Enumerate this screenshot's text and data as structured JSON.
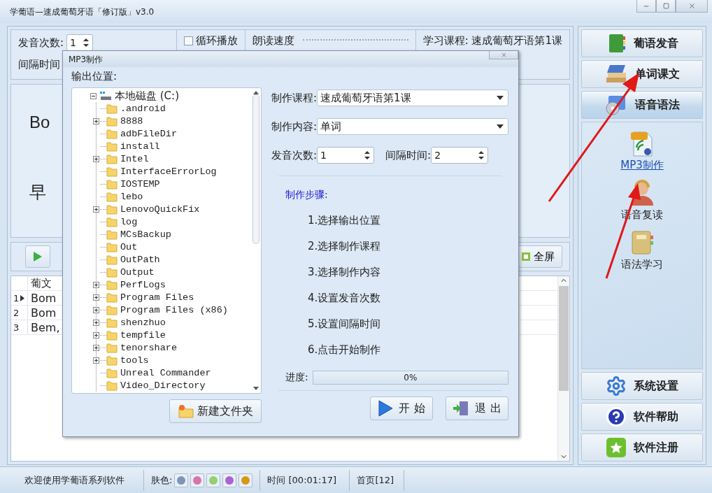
{
  "window": {
    "title": "学葡语—速成葡萄牙语「修订版」v3.0"
  },
  "settings_panel": {
    "repeat_label": "发音次数:",
    "repeat_value": "1",
    "interval_label": "间隔时间",
    "loop": {
      "label": "循环播放",
      "checked": false
    },
    "speed_label": "朗读速度",
    "course": "学习课程: 速成葡萄牙语第1课"
  },
  "display": {
    "word": "Bo",
    "translation": "早"
  },
  "toolbar": {
    "fullscreen_label": "全屏"
  },
  "table": {
    "columns": [
      "葡文"
    ],
    "rows": [
      {
        "index": "1",
        "current": true,
        "text": "Bom"
      },
      {
        "index": "2",
        "current": false,
        "text": "Bom"
      },
      {
        "index": "3",
        "current": false,
        "text": "Bem,"
      }
    ]
  },
  "sidebar": {
    "sections": [
      {
        "label": "葡语发音",
        "selected": false
      },
      {
        "label": "单词课文",
        "selected": false
      },
      {
        "label": "语音语法",
        "selected": true
      }
    ],
    "items": [
      {
        "label": "MP3制作",
        "selected": true
      },
      {
        "label": "语音复读",
        "selected": false
      },
      {
        "label": "语法学习",
        "selected": false
      }
    ],
    "bottom": [
      {
        "label": "系统设置"
      },
      {
        "label": "软件帮助"
      },
      {
        "label": "软件注册"
      }
    ]
  },
  "dialog": {
    "title": "MP3制作",
    "output_label": "输出位置:",
    "tree": [
      {
        "label": "本地磁盘 (C:)",
        "expanded": true,
        "children": [
          {
            "label": ".android",
            "expandable": false
          },
          {
            "label": "8888",
            "expandable": true
          },
          {
            "label": "adbFileDir",
            "expandable": false
          },
          {
            "label": "install",
            "expandable": false
          },
          {
            "label": "Intel",
            "expandable": true
          },
          {
            "label": "InterfaceErrorLog",
            "expandable": false
          },
          {
            "label": "IOSTEMP",
            "expandable": false
          },
          {
            "label": "lebo",
            "expandable": false
          },
          {
            "label": "LenovoQuickFix",
            "expandable": true
          },
          {
            "label": "log",
            "expandable": false
          },
          {
            "label": "MCsBackup",
            "expandable": false
          },
          {
            "label": "Out",
            "expandable": false
          },
          {
            "label": "OutPath",
            "expandable": false
          },
          {
            "label": "Output",
            "expandable": false
          },
          {
            "label": "PerfLogs",
            "expandable": true
          },
          {
            "label": "Program Files",
            "expandable": true
          },
          {
            "label": "Program Files (x86)",
            "expandable": true
          },
          {
            "label": "shenzhuo",
            "expandable": true
          },
          {
            "label": "tempfile",
            "expandable": true
          },
          {
            "label": "tenorshare",
            "expandable": true
          },
          {
            "label": "tools",
            "expandable": true
          },
          {
            "label": "Unreal Commander",
            "expandable": false
          },
          {
            "label": "Video_Directory",
            "expandable": false
          }
        ]
      }
    ],
    "new_folder_button": "新建文件夹",
    "course": {
      "label": "制作课程:",
      "value": "速成葡萄牙语第1课"
    },
    "content": {
      "label": "制作内容:",
      "value": "单词"
    },
    "repeat": {
      "label": "发音次数:",
      "value": "1"
    },
    "interval": {
      "label": "间隔时间:",
      "value": "2"
    },
    "steps_title": "制作步骤:",
    "steps": [
      "1.选择输出位置",
      "2.选择制作课程",
      "3.选择制作内容",
      "4.设置发音次数",
      "5.设置间隔时间",
      "6.点击开始制作"
    ],
    "progress": {
      "label": "进度:",
      "level": 0,
      "text": "0%"
    },
    "start_button": "开 始",
    "exit_button": "退 出"
  },
  "status_bar": {
    "welcome": "欢迎使用学葡语系列软件",
    "skin_label": "肤色:",
    "skins": [
      {
        "color": "#7b96b6"
      },
      {
        "color": "#d774ae"
      },
      {
        "color": "#93d06e"
      },
      {
        "color": "#a864d4"
      },
      {
        "color": "#d59a10"
      }
    ],
    "time": "时间 [00:01:17]",
    "page": "首页[12]"
  }
}
